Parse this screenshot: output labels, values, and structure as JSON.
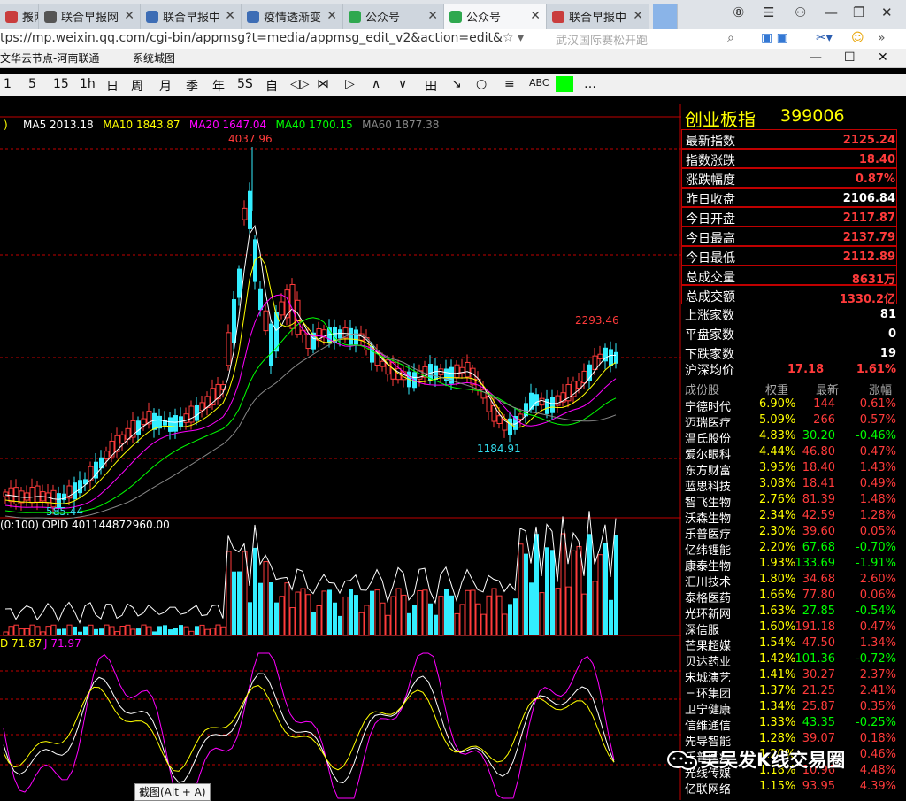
{
  "browser": {
    "tabs": [
      {
        "label": "报两",
        "color": "#c93d3d",
        "active": false
      },
      {
        "label": "联合早报网",
        "color": "#555555",
        "active": false
      },
      {
        "label": "联合早报中",
        "color": "#3d6db5",
        "active": false
      },
      {
        "label": "疫情透渐变",
        "color": "#3d6db5",
        "active": false
      },
      {
        "label": "公众号",
        "color": "#2fa84f",
        "active": false
      },
      {
        "label": "公众号",
        "color": "#2fa84f",
        "active": true
      },
      {
        "label": "联合早报中",
        "color": "#c93d3d",
        "active": false
      }
    ],
    "url": "tps://mp.weixin.qq.com/cgi-bin/appmsg?t=media/appmsg_edit_v2&action=edit&",
    "search_placeholder": "武汉国际赛松开跑"
  },
  "window": {
    "title_left": "文华云节点-河南联通",
    "title_menu": "系统城图"
  },
  "toolbar": {
    "items": [
      "1",
      "5",
      "15",
      "1h",
      "日",
      "周",
      "月",
      "季",
      "年",
      "5S",
      "自",
      "◁▷",
      "⋈",
      "▷",
      "∧",
      "∨",
      "田",
      "↘",
      "○",
      "≡",
      "ABC"
    ],
    "color_swatch": "#00ff00",
    "more": "…"
  },
  "indicators": {
    "ma": [
      {
        "label": "MA5",
        "value": "2013.18",
        "color": "#ffffff"
      },
      {
        "label": "MA10",
        "value": "1843.87",
        "color": "#ffff00"
      },
      {
        "label": "MA20",
        "value": "1647.04",
        "color": "#ff00ff"
      },
      {
        "label": "MA40",
        "value": "1700.15",
        "color": "#00ff00"
      },
      {
        "label": "MA60",
        "value": "1877.38",
        "color": "#888888"
      }
    ],
    "vol_label": "(0:100)  OPID 401144872960.00",
    "kdj_d": "D 71.87",
    "kdj_j": "J 71.97"
  },
  "chart_data": {
    "type": "candlestick",
    "annotations": {
      "high": "4037.96",
      "low": "585.44",
      "recent_high": "2293.46",
      "recent_low": "1184.91"
    }
  },
  "quote": {
    "name": "创业板指",
    "code": "399006",
    "stats": [
      {
        "label": "最新指数",
        "value": "2125.24",
        "color": "#ff3b3b"
      },
      {
        "label": "指数涨跌",
        "value": "18.40",
        "color": "#ff3b3b"
      },
      {
        "label": "涨跌幅度",
        "value": "0.87%",
        "color": "#ff3b3b"
      },
      {
        "label": "昨日收盘",
        "value": "2106.84",
        "color": "#ffffff"
      },
      {
        "label": "今日开盘",
        "value": "2117.87",
        "color": "#ff3b3b"
      },
      {
        "label": "今日最高",
        "value": "2137.79",
        "color": "#ff3b3b"
      },
      {
        "label": "今日最低",
        "value": "2112.89",
        "color": "#ff3b3b"
      },
      {
        "label": "总成交量",
        "value": "8631万",
        "color": "#ff3b3b"
      },
      {
        "label": "总成交额",
        "value": "1330.2亿",
        "color": "#ff3b3b"
      },
      {
        "label": "上涨家数",
        "value": "81",
        "color": "#ffffff"
      },
      {
        "label": "平盘家数",
        "value": "0",
        "color": "#ffffff"
      },
      {
        "label": "下跌家数",
        "value": "19",
        "color": "#ffffff"
      }
    ],
    "avg_label": "沪深均价",
    "avg_value": "17.18",
    "avg_pct": "1.61%",
    "cons_headers": [
      "成份股",
      "权重",
      "最新",
      "涨幅"
    ],
    "constituents": [
      [
        "宁德时代",
        "6.90%",
        "144",
        "0.61%",
        "up"
      ],
      [
        "迈瑞医疗",
        "5.09%",
        "266",
        "0.57%",
        "up"
      ],
      [
        "温氏股份",
        "4.83%",
        "30.20",
        "-0.46%",
        "down"
      ],
      [
        "爱尔眼科",
        "4.44%",
        "46.80",
        "0.47%",
        "up"
      ],
      [
        "东方财富",
        "3.95%",
        "18.40",
        "1.43%",
        "up"
      ],
      [
        "蓝思科技",
        "3.08%",
        "18.41",
        "0.49%",
        "up"
      ],
      [
        "智飞生物",
        "2.76%",
        "81.39",
        "1.48%",
        "up"
      ],
      [
        "沃森生物",
        "2.34%",
        "42.59",
        "1.28%",
        "up"
      ],
      [
        "乐普医疗",
        "2.30%",
        "39.60",
        "0.05%",
        "up"
      ],
      [
        "亿纬锂能",
        "2.20%",
        "67.68",
        "-0.70%",
        "down"
      ],
      [
        "康泰生物",
        "1.93%",
        "133.69",
        "-1.91%",
        "down"
      ],
      [
        "汇川技术",
        "1.80%",
        "34.68",
        "2.60%",
        "up"
      ],
      [
        "泰格医药",
        "1.66%",
        "77.80",
        "0.06%",
        "up"
      ],
      [
        "光环新网",
        "1.63%",
        "27.85",
        "-0.54%",
        "down"
      ],
      [
        "深信服",
        "1.60%",
        "191.18",
        "0.47%",
        "up"
      ],
      [
        "芒果超媒",
        "1.54%",
        "47.50",
        "1.34%",
        "up"
      ],
      [
        "贝达药业",
        "1.42%",
        "101.36",
        "-0.72%",
        "down"
      ],
      [
        "宋城演艺",
        "1.41%",
        "30.27",
        "2.37%",
        "up"
      ],
      [
        "三环集团",
        "1.37%",
        "21.25",
        "2.41%",
        "up"
      ],
      [
        "卫宁健康",
        "1.34%",
        "25.87",
        "0.35%",
        "up"
      ],
      [
        "信维通信",
        "1.33%",
        "43.35",
        "-0.25%",
        "down"
      ],
      [
        "先导智能",
        "1.28%",
        "39.07",
        "0.18%",
        "up"
      ],
      [
        "乐普医疗",
        "1.20%",
        "",
        "0.46%",
        "up"
      ],
      [
        "光线传媒",
        "1.18%",
        "10.96",
        "4.48%",
        "up"
      ],
      [
        "亿联网络",
        "1.15%",
        "93.95",
        "4.39%",
        "up"
      ]
    ]
  },
  "screenshot_tooltip": "截图(Alt + A)",
  "watermark": "吴吴发K线交易圈"
}
